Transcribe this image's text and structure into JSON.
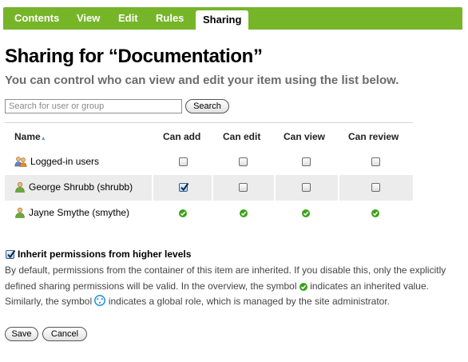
{
  "tabs": [
    "Contents",
    "View",
    "Edit",
    "Rules",
    "Sharing"
  ],
  "active_tab": "Sharing",
  "title": "Sharing for “Documentation”",
  "subtitle": "You can control who can view and edit your item using the list below.",
  "search": {
    "placeholder": "Search for user or group",
    "value": "",
    "button_label": "Search"
  },
  "table": {
    "headers": {
      "name": "Name",
      "can_add": "Can add",
      "can_edit": "Can edit",
      "can_view": "Can view",
      "can_review": "Can review"
    },
    "rows": [
      {
        "name": "Logged-in users",
        "icon": "group-icon",
        "cells": [
          "unchecked",
          "unchecked",
          "unchecked",
          "unchecked"
        ]
      },
      {
        "name": "George Shrubb (shrubb)",
        "icon": "user-icon",
        "cells": [
          "checked",
          "unchecked",
          "unchecked",
          "unchecked"
        ]
      },
      {
        "name": "Jayne Smythe (smythe)",
        "icon": "user-icon",
        "cells": [
          "inherited",
          "inherited",
          "inherited",
          "inherited"
        ]
      }
    ]
  },
  "inherit": {
    "checked": true,
    "label": "Inherit permissions from higher levels",
    "desc_part1": "By default, permissions from the container of this item are inherited. If you disable this, only the explicitly defined sharing permissions will be valid. In the overview, the symbol",
    "desc_part2": "indicates an inherited value. Similarly, the symbol",
    "desc_part3": "indicates a global role, which is managed by the site administrator."
  },
  "actions": {
    "save_label": "Save",
    "cancel_label": "Cancel"
  },
  "colors": {
    "tab_bar": "#76b528",
    "subtitle": "#6b6b6b",
    "inherited_icon": "#3aa31b",
    "global_role_icon": "#1a8fd6"
  }
}
